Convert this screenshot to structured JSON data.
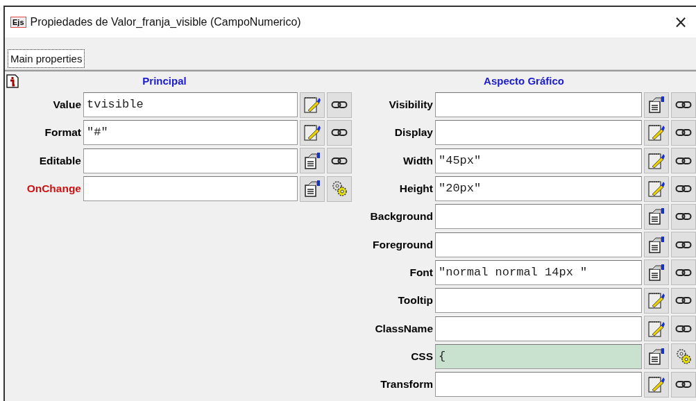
{
  "window": {
    "badge": "Ejs",
    "title": "Propiedades de Valor_franja_visible (CampoNumerico)",
    "close": "×"
  },
  "tabs": [
    {
      "label": "Main properties",
      "selected": true
    }
  ],
  "sections": [
    {
      "title": "Principal",
      "rows": [
        {
          "label": "Value",
          "value": "tvisible",
          "color": "#000000",
          "highlighted": false,
          "buttons": [
            {
              "kind": "notepad"
            },
            {
              "kind": "link"
            }
          ]
        },
        {
          "label": "Format",
          "value": "\"#\"",
          "color": "#000000",
          "highlighted": false,
          "buttons": [
            {
              "kind": "notepad"
            },
            {
              "kind": "link"
            }
          ]
        },
        {
          "label": "Editable",
          "value": "",
          "color": "#000000",
          "highlighted": false,
          "buttons": [
            {
              "kind": "sheet"
            },
            {
              "kind": "link"
            }
          ]
        },
        {
          "label": "OnChange",
          "value": "",
          "color": "#cc1111",
          "highlighted": false,
          "buttons": [
            {
              "kind": "sheet"
            },
            {
              "kind": "gear"
            }
          ]
        }
      ]
    },
    {
      "title": "Aspecto Gráfico",
      "rows": [
        {
          "label": "Visibility",
          "value": "",
          "color": "#000000",
          "highlighted": false,
          "buttons": [
            {
              "kind": "sheet"
            },
            {
              "kind": "link"
            }
          ]
        },
        {
          "label": "Display",
          "value": "",
          "color": "#000000",
          "highlighted": false,
          "buttons": [
            {
              "kind": "notepad"
            },
            {
              "kind": "link"
            }
          ]
        },
        {
          "label": "Width",
          "value": "\"45px\"",
          "color": "#000000",
          "highlighted": false,
          "buttons": [
            {
              "kind": "notepad"
            },
            {
              "kind": "link"
            }
          ]
        },
        {
          "label": "Height",
          "value": "\"20px\"",
          "color": "#000000",
          "highlighted": false,
          "buttons": [
            {
              "kind": "notepad"
            },
            {
              "kind": "link"
            }
          ]
        },
        {
          "label": "Background",
          "value": "",
          "color": "#000000",
          "highlighted": false,
          "buttons": [
            {
              "kind": "sheet"
            },
            {
              "kind": "link"
            }
          ]
        },
        {
          "label": "Foreground",
          "value": "",
          "color": "#000000",
          "highlighted": false,
          "buttons": [
            {
              "kind": "sheet"
            },
            {
              "kind": "link"
            }
          ]
        },
        {
          "label": "Font",
          "value": "\"normal normal 14px \"",
          "color": "#000000",
          "highlighted": false,
          "buttons": [
            {
              "kind": "sheet"
            },
            {
              "kind": "link"
            }
          ]
        },
        {
          "label": "Tooltip",
          "value": "",
          "color": "#000000",
          "highlighted": false,
          "buttons": [
            {
              "kind": "notepad"
            },
            {
              "kind": "link"
            }
          ]
        },
        {
          "label": "ClassName",
          "value": "",
          "color": "#000000",
          "highlighted": false,
          "buttons": [
            {
              "kind": "notepad"
            },
            {
              "kind": "link"
            }
          ]
        },
        {
          "label": "CSS",
          "value": "{",
          "color": "#000000",
          "highlighted": true,
          "buttons": [
            {
              "kind": "sheet"
            },
            {
              "kind": "gear"
            }
          ]
        },
        {
          "label": "Transform",
          "value": "",
          "color": "#000000",
          "highlighted": false,
          "buttons": [
            {
              "kind": "notepad"
            },
            {
              "kind": "link"
            }
          ]
        }
      ]
    }
  ]
}
